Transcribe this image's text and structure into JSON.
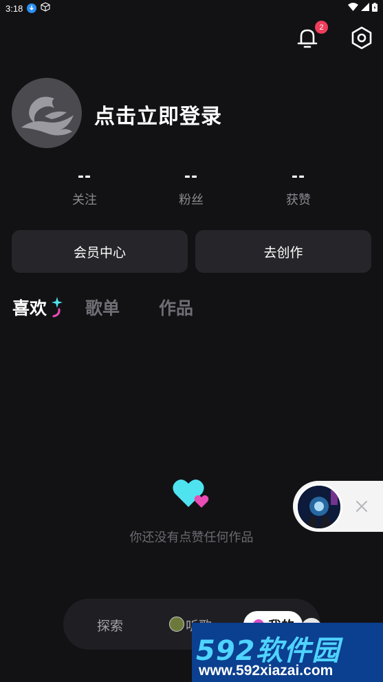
{
  "status_bar": {
    "time": "3:18",
    "icons": [
      "download-icon",
      "cube-icon",
      "wifi-icon",
      "signal-icon",
      "battery-icon"
    ]
  },
  "header": {
    "notification_count": "2",
    "icons": [
      "bell-icon",
      "settings-icon"
    ]
  },
  "profile": {
    "login_prompt": "点击立即登录"
  },
  "stats": [
    {
      "value": "--",
      "label": "关注"
    },
    {
      "value": "--",
      "label": "粉丝"
    },
    {
      "value": "--",
      "label": "获赞"
    }
  ],
  "actions": {
    "vip_center": "会员中心",
    "create": "去创作"
  },
  "tabs": [
    {
      "label": "喜欢",
      "active": true
    },
    {
      "label": "歌单",
      "active": false
    },
    {
      "label": "作品",
      "active": false
    }
  ],
  "empty_state": {
    "message": "你还没有点赞任何作品"
  },
  "bottom_nav": {
    "explore": "探索",
    "listen": "听歌",
    "mine": "我的"
  },
  "watermark": {
    "brand": "592软件园",
    "url": "www.592xiazai.com"
  },
  "colors": {
    "background": "#121215",
    "card": "#25252a",
    "badge": "#ee3e5b",
    "accent_cyan": "#4fe3f0",
    "accent_pink": "#e84cb5"
  }
}
